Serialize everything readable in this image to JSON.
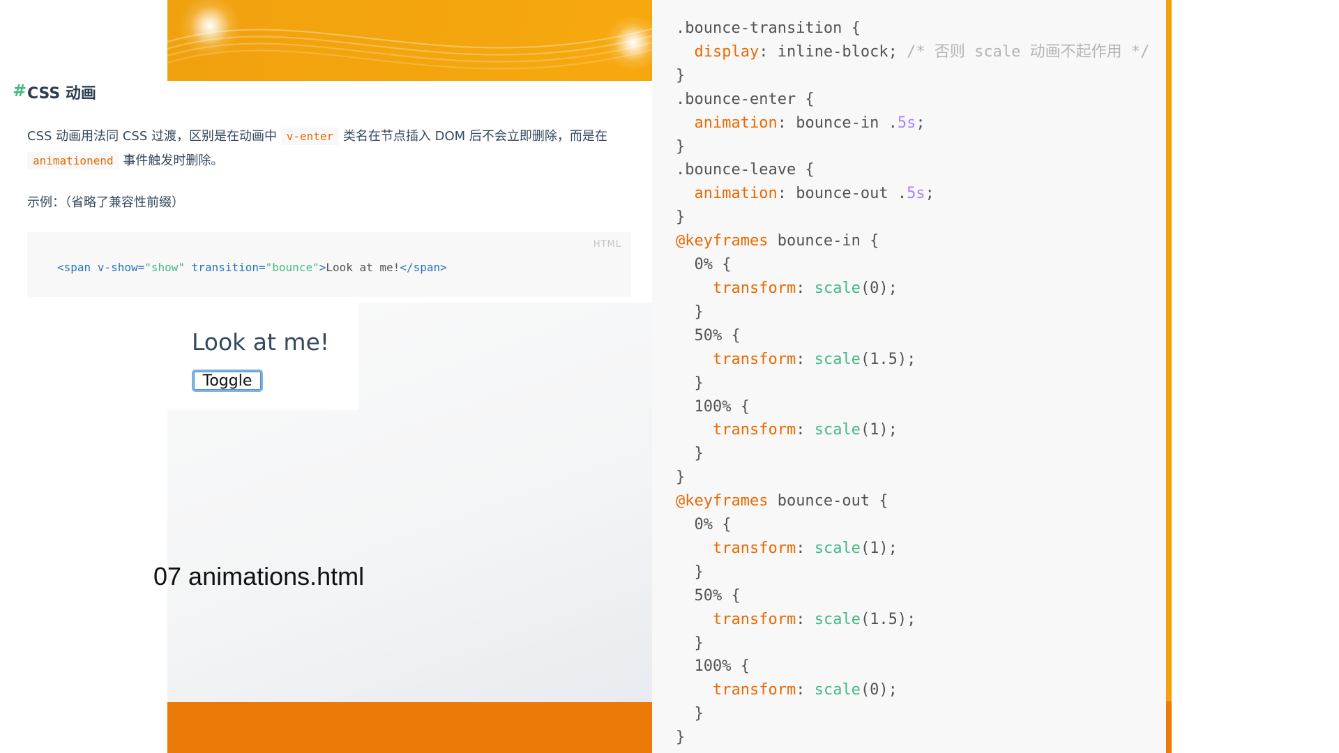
{
  "doc": {
    "hash": "#",
    "heading": "CSS 动画",
    "para_1": "CSS 动画用法同 CSS 过渡，区别是在动画中 ",
    "code_1": "v-enter",
    "para_2": " 类名在节点插入 DOM 后不会立即删除，而是在 ",
    "code_2": "animationend",
    "para_3": " 事件触发时删除。",
    "example_label": "示例：（省略了兼容性前缀）",
    "codebox": {
      "lang": "HTML",
      "parts": [
        "<span ",
        "v-show=",
        "\"show\"",
        " ",
        "transition=",
        "\"bounce\"",
        ">",
        "Look at me!",
        "</span>"
      ]
    }
  },
  "demo": {
    "text": "Look at me!",
    "toggle_label": "Toggle"
  },
  "caption": "07 animations.html",
  "css_code": {
    "lines": [
      [
        [
          "",
          ".bounce-transition {"
        ]
      ],
      [
        [
          "",
          "  "
        ],
        [
          "prop",
          "display"
        ],
        [
          "",
          ": inline-block; "
        ],
        [
          "com",
          "/* 否则 scale 动画不起作用 */"
        ]
      ],
      [
        [
          "",
          "}"
        ]
      ],
      [
        [
          "",
          ".bounce-enter {"
        ]
      ],
      [
        [
          "",
          "  "
        ],
        [
          "prop",
          "animation"
        ],
        [
          "",
          ": bounce-in ."
        ],
        [
          "num",
          "5s"
        ],
        [
          "",
          ";"
        ]
      ],
      [
        [
          "",
          "}"
        ]
      ],
      [
        [
          "",
          ".bounce-leave {"
        ]
      ],
      [
        [
          "",
          "  "
        ],
        [
          "prop",
          "animation"
        ],
        [
          "",
          ": bounce-out ."
        ],
        [
          "num",
          "5s"
        ],
        [
          "",
          ";"
        ]
      ],
      [
        [
          "",
          "}"
        ]
      ],
      [
        [
          "at",
          "@keyframes"
        ],
        [
          "",
          " bounce-in {"
        ]
      ],
      [
        [
          "",
          "  0% {"
        ]
      ],
      [
        [
          "",
          "    "
        ],
        [
          "prop",
          "transform"
        ],
        [
          "",
          ": "
        ],
        [
          "fn",
          "scale"
        ],
        [
          "",
          "(0);"
        ]
      ],
      [
        [
          "",
          "  }"
        ]
      ],
      [
        [
          "",
          "  50% {"
        ]
      ],
      [
        [
          "",
          "    "
        ],
        [
          "prop",
          "transform"
        ],
        [
          "",
          ": "
        ],
        [
          "fn",
          "scale"
        ],
        [
          "",
          "(1.5);"
        ]
      ],
      [
        [
          "",
          "  }"
        ]
      ],
      [
        [
          "",
          "  100% {"
        ]
      ],
      [
        [
          "",
          "    "
        ],
        [
          "prop",
          "transform"
        ],
        [
          "",
          ": "
        ],
        [
          "fn",
          "scale"
        ],
        [
          "",
          "(1);"
        ]
      ],
      [
        [
          "",
          "  }"
        ]
      ],
      [
        [
          "",
          "}"
        ]
      ],
      [
        [
          "at",
          "@keyframes"
        ],
        [
          "",
          " bounce-out {"
        ]
      ],
      [
        [
          "",
          "  0% {"
        ]
      ],
      [
        [
          "",
          "    "
        ],
        [
          "prop",
          "transform"
        ],
        [
          "",
          ": "
        ],
        [
          "fn",
          "scale"
        ],
        [
          "",
          "(1);"
        ]
      ],
      [
        [
          "",
          "  }"
        ]
      ],
      [
        [
          "",
          "  50% {"
        ]
      ],
      [
        [
          "",
          "    "
        ],
        [
          "prop",
          "transform"
        ],
        [
          "",
          ": "
        ],
        [
          "fn",
          "scale"
        ],
        [
          "",
          "(1.5);"
        ]
      ],
      [
        [
          "",
          "  }"
        ]
      ],
      [
        [
          "",
          "  100% {"
        ]
      ],
      [
        [
          "",
          "    "
        ],
        [
          "prop",
          "transform"
        ],
        [
          "",
          ": "
        ],
        [
          "fn",
          "scale"
        ],
        [
          "",
          "(0);"
        ]
      ],
      [
        [
          "",
          "  }"
        ]
      ],
      [
        [
          "",
          "}"
        ]
      ]
    ]
  },
  "colors": {
    "accent_green": "#42b983",
    "code_orange": "#e96900",
    "number_purple": "#ae81ff",
    "banner_orange": "#f6a80e",
    "bottom_orange": "#ec7a08"
  }
}
